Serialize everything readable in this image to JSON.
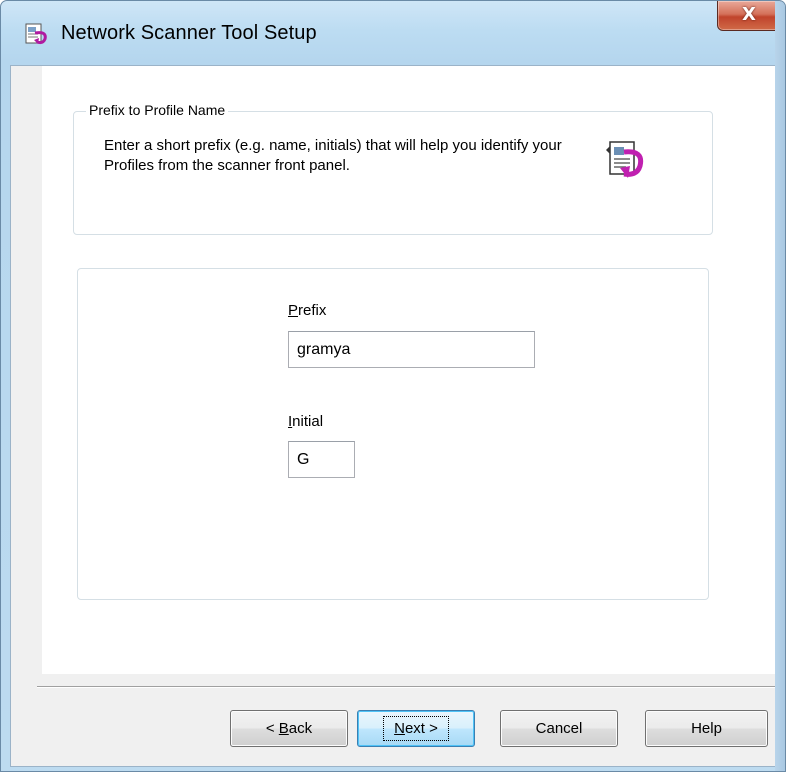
{
  "window": {
    "title": "Network Scanner Tool Setup",
    "close_glyph": "X",
    "app_icon": "scanner-setup-icon"
  },
  "group": {
    "legend": "Prefix to Profile Name",
    "description": "Enter a short prefix (e.g. name, initials) that will help you identify your Profiles from the scanner front panel.",
    "icon": "profile-document-icon"
  },
  "form": {
    "prefix_label_accel": "P",
    "prefix_label_rest": "refix",
    "prefix_value": "gramya",
    "initial_label_accel": "I",
    "initial_label_rest": "nitial",
    "initial_value": "G"
  },
  "buttons": {
    "back_prefix": "< ",
    "back_accel": "B",
    "back_rest": "ack",
    "next_accel": "N",
    "next_rest": "ext >",
    "cancel": "Cancel",
    "help": "Help"
  },
  "colors": {
    "titlebar": "#bcdcf2",
    "close_button": "#c0442c",
    "dialog_face": "#f0f0f0",
    "default_button": "#bee6fd"
  }
}
